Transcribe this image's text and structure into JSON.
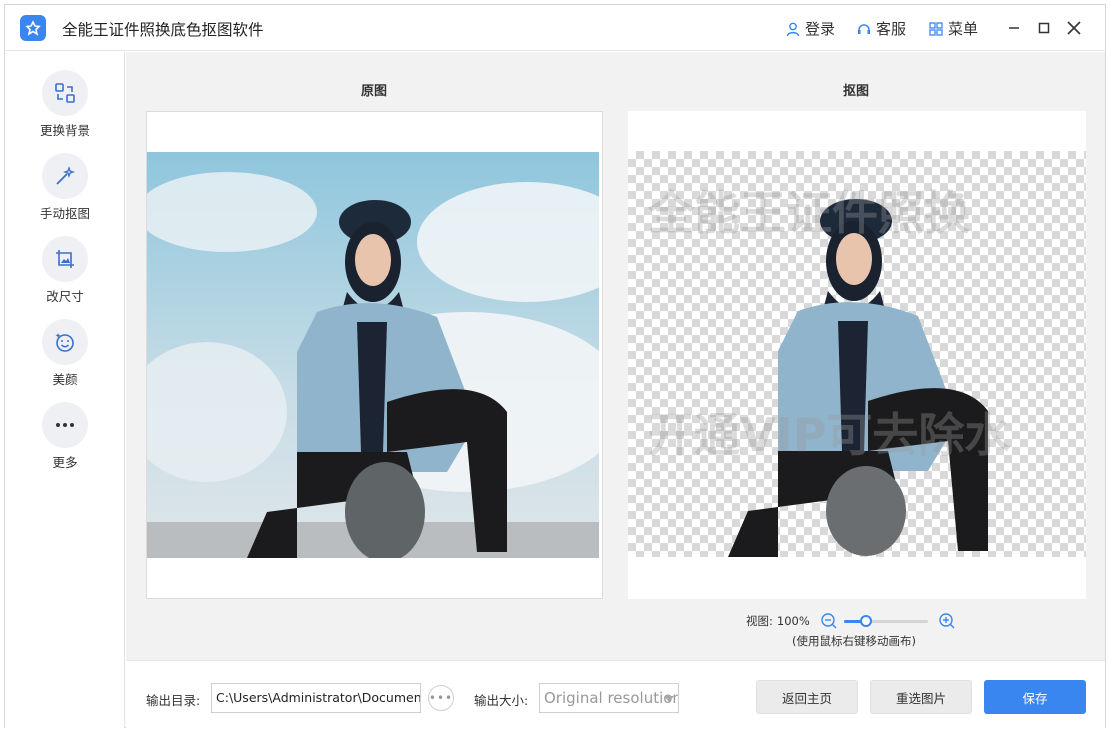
{
  "app": {
    "title": "全能王证件照换底色抠图软件"
  },
  "titlebar": {
    "login": "登录",
    "service": "客服",
    "menu": "菜单"
  },
  "sidebar": {
    "items": [
      {
        "label": "更换背景",
        "icon": "swap-background-icon"
      },
      {
        "label": "手动抠图",
        "icon": "magic-wand-icon"
      },
      {
        "label": "改尺寸",
        "icon": "crop-image-icon"
      },
      {
        "label": "美颜",
        "icon": "beauty-face-icon"
      },
      {
        "label": "更多",
        "icon": "more-dots-icon"
      }
    ]
  },
  "main": {
    "original_title": "原图",
    "cutout_title": "抠图",
    "watermark_line1": "全能王证件照换",
    "watermark_line2": "开通VIP可去除水",
    "zoom_label": "视图:",
    "zoom_value": "100%",
    "zoom_fraction": 0.27,
    "zoom_hint": "(使用鼠标右键移动画布)"
  },
  "bottom": {
    "output_dir_label": "输出目录:",
    "output_dir_value": "C:\\Users\\Administrator\\Documents\\",
    "output_size_label": "输出大小:",
    "output_size_value": "Original resolution",
    "back_button": "返回主页",
    "reselect_button": "重选图片",
    "save_button": "保存"
  },
  "colors": {
    "accent": "#3a86f0",
    "sidebar_circle": "#eef0f4",
    "main_bg": "#f2f2f2"
  }
}
